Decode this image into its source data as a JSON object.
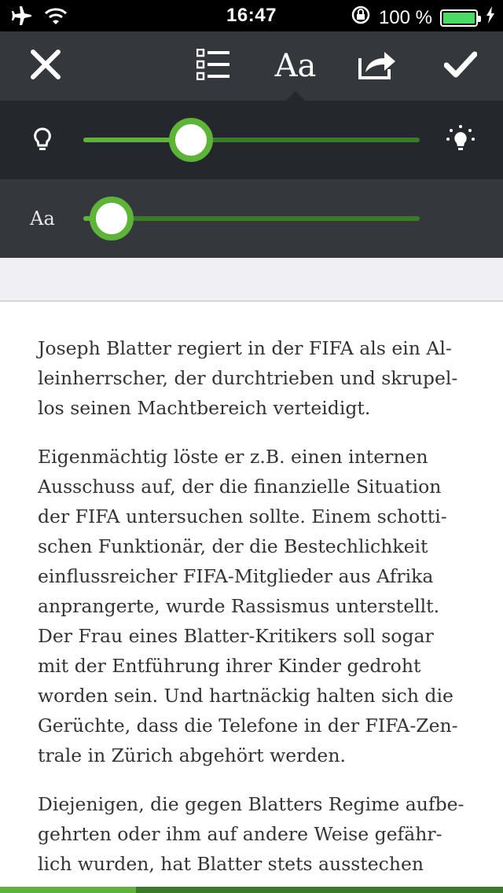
{
  "status_bar": {
    "time": "16:47",
    "battery_text": "100 %",
    "icons": [
      "airplane-icon",
      "wifi-icon",
      "rotation-lock-icon",
      "battery-icon",
      "charging-icon"
    ]
  },
  "toolbar": {
    "font_button_label": "Aa",
    "icons": [
      "close-icon",
      "list-icon",
      "font-icon",
      "share-icon",
      "checkmark-icon"
    ]
  },
  "brightness": {
    "icons": [
      "bulb-dim-icon",
      "bulb-bright-icon"
    ],
    "value": 0.32
  },
  "font_size": {
    "label": "Aa",
    "value": 0.085
  },
  "colors": {
    "accent": "#5fb33a",
    "track_dark": "#3a7a2a",
    "toolbar_bg": "#34383c",
    "panel_bg": "#24282c"
  },
  "article": {
    "paragraphs": [
      {
        "lines": [
          "Joseph Blatter regiert in der FIFA als ein Al-",
          "leinherrscher, der durchtrieben und skrupel-",
          "los seinen Machtbereich verteidigt."
        ]
      },
      {
        "lines": [
          "Eigenmächtig löste er z.B. einen internen",
          "Ausschuss auf, der die finanzielle Situation",
          "der FIFA untersuchen sollte. Einem schotti-",
          "schen Funktionär, der die Bestechlichkeit",
          "einflussreicher FIFA-Mitglieder aus Afrika",
          "anprangerte, wurde Rassismus unterstellt.",
          "Der Frau eines Blatter-Kritikers soll sogar",
          "mit der Entführung ihrer Kinder gedroht",
          "worden sein. Und hartnäckig halten sich die",
          "Gerüchte, dass die Telefone in der FIFA-Zen-",
          "trale in Zürich abgehört werden."
        ]
      },
      {
        "lines": [
          "Diejenigen, die gegen Blatters Regime aufbe-",
          "gehrten oder ihm auf andere Weise gefähr-",
          "lich wurden, hat Blatter stets ausstechen"
        ]
      }
    ]
  },
  "reading_progress": 0.27
}
